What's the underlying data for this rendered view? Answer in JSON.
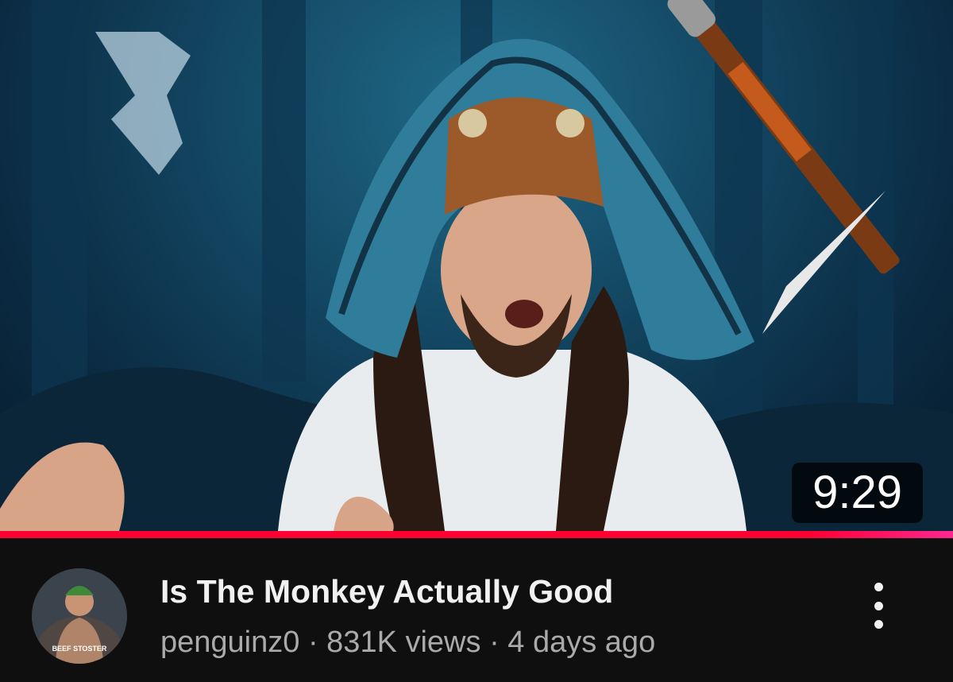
{
  "video": {
    "duration": "9:29",
    "watch_progress_fraction": 1.0,
    "thumbnail_icon": "video-thumbnail"
  },
  "meta": {
    "title": "Is The Monkey Actually Good",
    "channel": "penguinz0",
    "separator": "·",
    "views": "831K views",
    "age": "4 days ago",
    "avatar_text": "BEEF STOSTER",
    "menu_icon": "more-vertical-icon"
  },
  "colors": {
    "background": "#0f0f0f",
    "progress": "#ff0033",
    "title_text": "#f1f1f1",
    "secondary_text": "#aaaaaa"
  }
}
